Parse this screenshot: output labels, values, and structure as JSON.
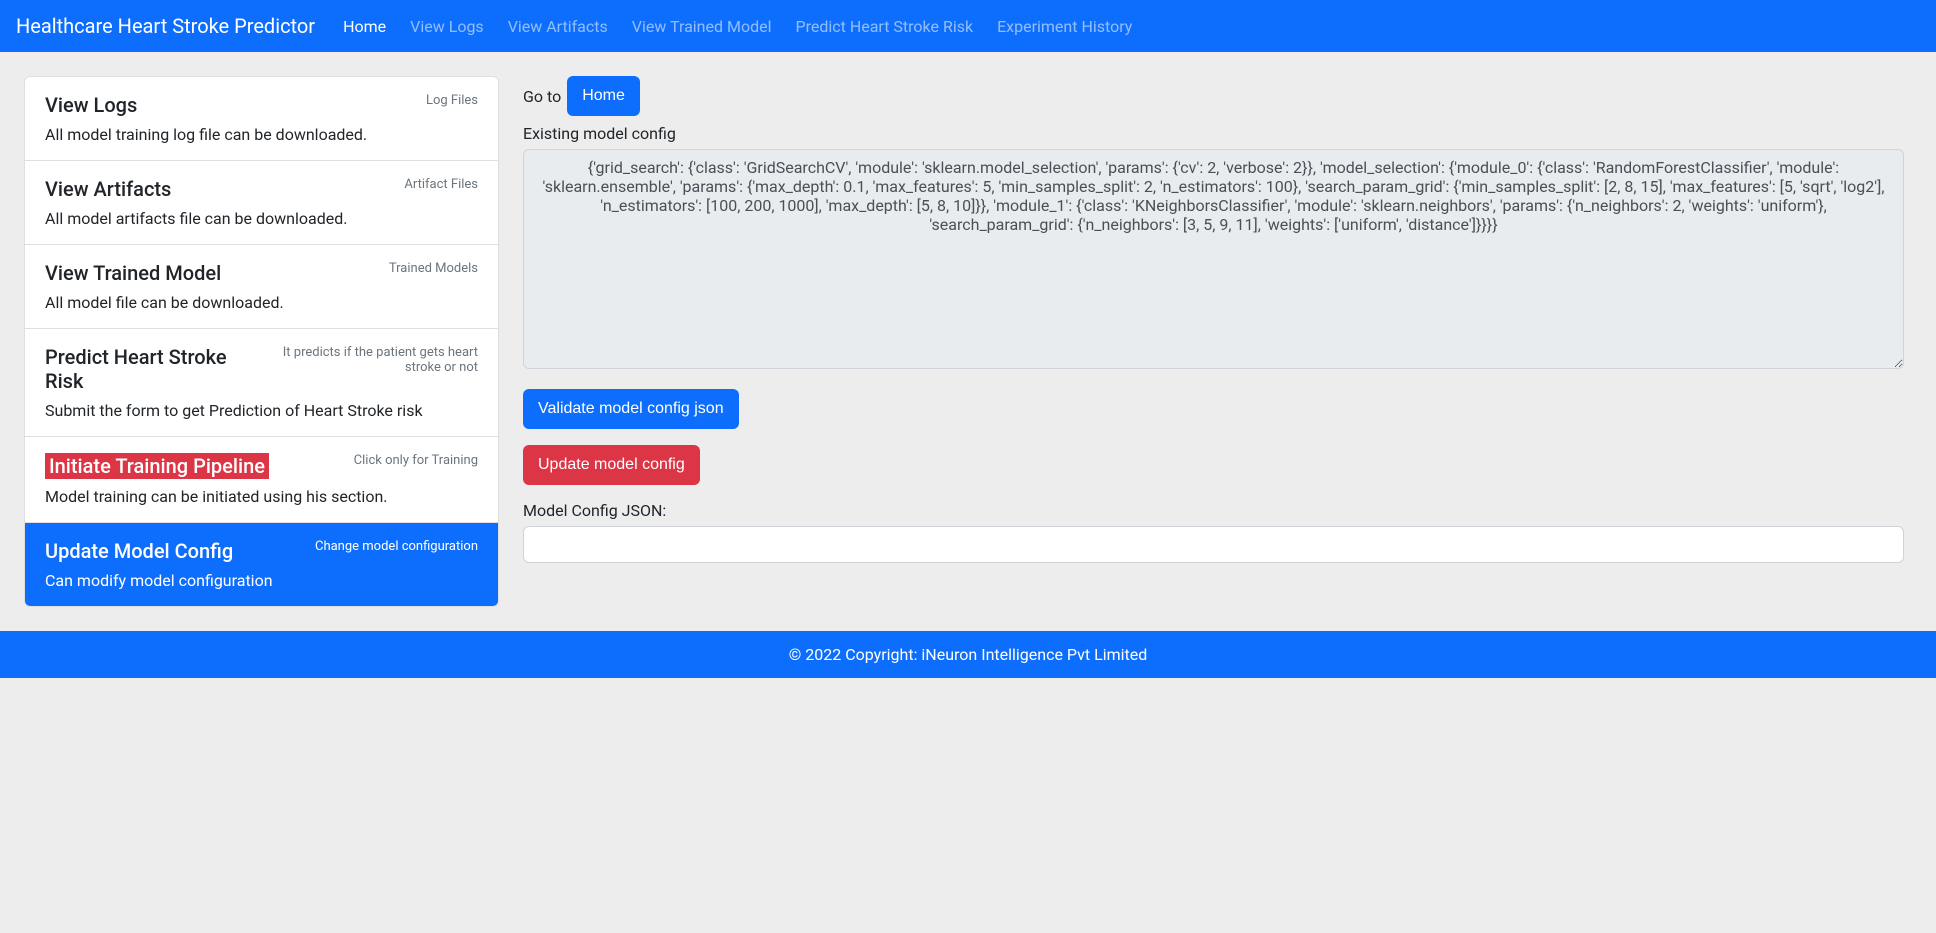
{
  "navbar": {
    "brand": "Healthcare Heart Stroke Predictor",
    "links": [
      {
        "label": "Home",
        "active": true
      },
      {
        "label": "View Logs",
        "active": false
      },
      {
        "label": "View Artifacts",
        "active": false
      },
      {
        "label": "View Trained Model",
        "active": false
      },
      {
        "label": "Predict Heart Stroke Risk",
        "active": false
      },
      {
        "label": "Experiment History",
        "active": false
      }
    ]
  },
  "sidebar": {
    "items": [
      {
        "title": "View Logs",
        "small": "Log Files",
        "desc": "All model training log file can be downloaded.",
        "highlight": false,
        "active": false
      },
      {
        "title": "View Artifacts",
        "small": "Artifact Files",
        "desc": "All model artifacts file can be downloaded.",
        "highlight": false,
        "active": false
      },
      {
        "title": "View Trained Model",
        "small": "Trained Models",
        "desc": "All model file can be downloaded.",
        "highlight": false,
        "active": false
      },
      {
        "title": "Predict Heart Stroke Risk",
        "small": "It predicts if the patient gets heart stroke or not",
        "desc": "Submit the form to get Prediction of Heart Stroke risk",
        "highlight": false,
        "active": false
      },
      {
        "title": "Initiate Training Pipeline",
        "small": "Click only for Training",
        "desc": "Model training can be initiated using his section.",
        "highlight": true,
        "active": false
      },
      {
        "title": "Update Model Config",
        "small": "Change model configuration",
        "desc": "Can modify model configuration",
        "highlight": false,
        "active": true
      }
    ]
  },
  "main": {
    "goto_prefix": "Go to ",
    "goto_button": "Home",
    "existing_label": "Existing model config",
    "existing_value": "{'grid_search': {'class': 'GridSearchCV', 'module': 'sklearn.model_selection', 'params': {'cv': 2, 'verbose': 2}}, 'model_selection': {'module_0': {'class': 'RandomForestClassifier', 'module': 'sklearn.ensemble', 'params': {'max_depth': 0.1, 'max_features': 5, 'min_samples_split': 2, 'n_estimators': 100}, 'search_param_grid': {'min_samples_split': [2, 8, 15], 'max_features': [5, 'sqrt', 'log2'], 'n_estimators': [100, 200, 1000], 'max_depth': [5, 8, 10]}}, 'module_1': {'class': 'KNeighborsClassifier', 'module': 'sklearn.neighbors', 'params': {'n_neighbors': 2, 'weights': 'uniform'}, 'search_param_grid': {'n_neighbors': [3, 5, 9, 11], 'weights': ['uniform', 'distance']}}}}",
    "validate_button": "Validate model config json",
    "update_button": "Update model config",
    "json_label": "Model Config JSON:",
    "json_value": ""
  },
  "footer": {
    "copyright_prefix": "© 2022 Copyright: ",
    "company": "iNeuron Intelligence Pvt Limited"
  }
}
